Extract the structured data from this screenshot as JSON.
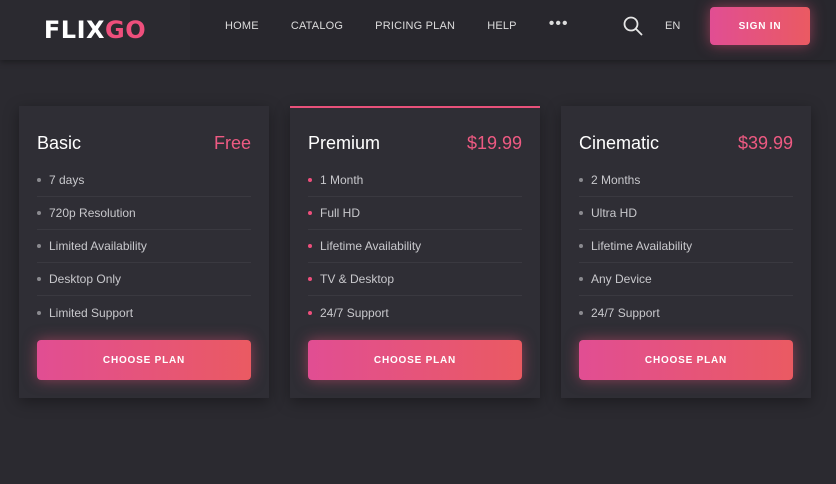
{
  "header": {
    "logo_part1": "FLIX",
    "logo_part2": "GO",
    "nav": [
      "HOME",
      "CATALOG",
      "PRICING PLAN",
      "HELP"
    ],
    "more_label": "•••",
    "search_icon": "search-icon",
    "language": "EN",
    "signin_label": "SIGN IN"
  },
  "colors": {
    "accent": "#ee4f7c",
    "gradient_start": "#e14e93",
    "gradient_end": "#ea5a62",
    "background": "#2b2a30",
    "card": "#2f2e35"
  },
  "plans": [
    {
      "name": "Basic",
      "price": "Free",
      "features": [
        "7 days",
        "720p Resolution",
        "Limited Availability",
        "Desktop Only",
        "Limited Support"
      ],
      "button": "CHOOSE PLAN"
    },
    {
      "name": "Premium",
      "price": "$19.99",
      "features": [
        "1 Month",
        "Full HD",
        "Lifetime Availability",
        "TV & Desktop",
        "24/7 Support"
      ],
      "button": "CHOOSE PLAN"
    },
    {
      "name": "Cinematic",
      "price": "$39.99",
      "features": [
        "2 Months",
        "Ultra HD",
        "Lifetime Availability",
        "Any Device",
        "24/7 Support"
      ],
      "button": "CHOOSE PLAN"
    }
  ]
}
